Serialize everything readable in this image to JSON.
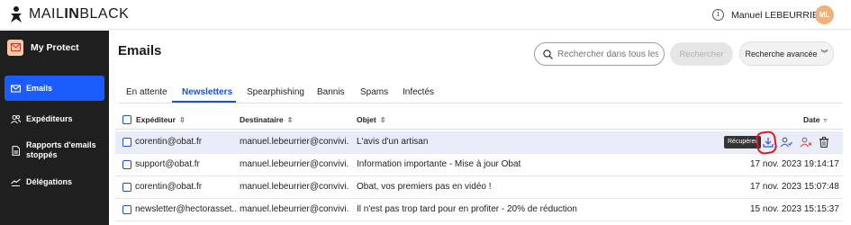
{
  "app": {
    "brand_regular": "MAIL",
    "brand_bold": "IN",
    "brand_regular2": "BLACK"
  },
  "header": {
    "user_name": "Manuel LEBEURRIER",
    "avatar_initials": "ML",
    "help_icon": "help-circle-icon"
  },
  "sidebar": {
    "app_name": "My Protect",
    "items": [
      {
        "label": "Emails",
        "icon": "mail-icon",
        "active": true
      },
      {
        "label": "Expéditeurs",
        "icon": "users-icon",
        "active": false
      },
      {
        "label": "Rapports d'emails stoppés",
        "icon": "report-icon",
        "active": false
      },
      {
        "label": "Délégations",
        "icon": "delegation-icon",
        "active": false
      }
    ]
  },
  "main": {
    "title": "Emails",
    "search": {
      "placeholder": "Rechercher dans tous les emails",
      "button": "Rechercher"
    },
    "advanced_search": "Recherche avancée",
    "tabs": [
      "En attente",
      "Newsletters",
      "Spearphishing",
      "Bannis",
      "Spams",
      "Infectés"
    ],
    "active_tab": "Newsletters"
  },
  "table": {
    "columns": {
      "sender": "Expéditeur",
      "recipient": "Destinataire",
      "subject": "Objet",
      "date": "Date"
    },
    "rows": [
      {
        "sender": "corentin@obat.fr",
        "recipient": "manuel.lebeurrier@convivi...",
        "subject": "L'avis d'un artisan",
        "date": "",
        "highlighted": true
      },
      {
        "sender": "support@obat.fr",
        "recipient": "manuel.lebeurrier@convivi...",
        "subject": "Information importante - Mise à jour Obat",
        "date": "17 nov. 2023 19:14:17",
        "highlighted": false
      },
      {
        "sender": "corentin@obat.fr",
        "recipient": "manuel.lebeurrier@convivi...",
        "subject": "Obat, vos premiers pas en vidéo !",
        "date": "17 nov. 2023 15:07:48",
        "highlighted": false
      },
      {
        "sender": "newsletter@hectorasset...",
        "recipient": "manuel.lebeurrier@convivi...",
        "subject": "Il n'est pas trop tard pour en profiter - 20% de réduction",
        "date": "15 nov. 2023 15:15:37",
        "highlighted": false
      }
    ],
    "row_actions": {
      "tooltip": "Récupérer",
      "icons": [
        "restore-icon",
        "approve-sender-icon",
        "block-sender-icon",
        "trash-icon"
      ]
    }
  },
  "colors": {
    "accent": "#1a5cff",
    "sidebar_bg": "#1f1f1f",
    "highlight_row": "#e8edf9",
    "avatar": "#f0b17a",
    "annotation": "#e0191f"
  }
}
